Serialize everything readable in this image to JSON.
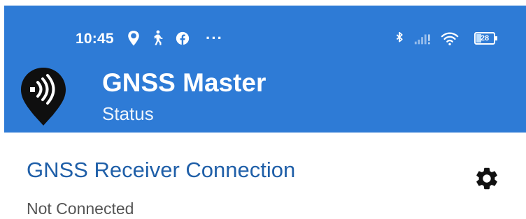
{
  "status_bar": {
    "time": "10:45",
    "left_icons": [
      "location-badge-icon",
      "walking-person-icon",
      "facebook-icon"
    ],
    "more_indicator": "···",
    "right_icons": [
      "bluetooth-icon",
      "cellular-signal-icon",
      "wifi-icon",
      "battery-icon"
    ],
    "battery_level": "28",
    "battery_fraction": 0.28
  },
  "app_bar": {
    "title": "GNSS Master",
    "subtitle": "Status",
    "logo_icon": "gnss-master-logo",
    "color": "#2e7bd6"
  },
  "section": {
    "title": "GNSS Receiver Connection",
    "status": "Not Connected",
    "settings_icon": "gear-icon",
    "title_color": "#1f5fa8"
  }
}
